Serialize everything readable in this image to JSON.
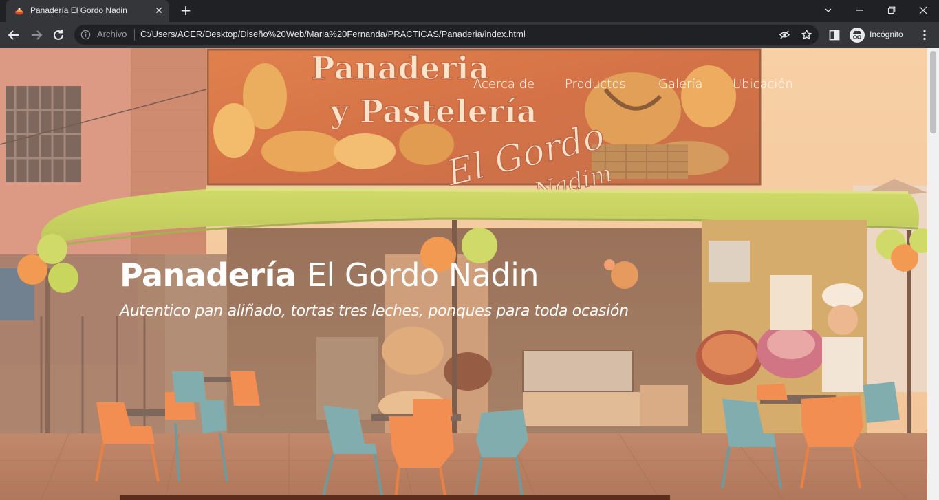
{
  "browser": {
    "tab_title": "Panadería El Gordo Nadin",
    "omnibox_scheme": "Archivo",
    "url": "C:/Users/ACER/Desktop/Diseño%20Web/Maria%20Fernanda/PRACTICAS/Panaderia/index.html",
    "profile_label": "Incógnito"
  },
  "nav": {
    "items": [
      "Acerca de",
      "Productos",
      "Galería",
      "Ubicación"
    ]
  },
  "hero": {
    "title_bold": "Panadería",
    "title_light": "El Gordo Nadin",
    "subtitle": "Autentico pan aliñado, tortas tres leches, ponques para toda ocasión"
  },
  "sign": {
    "line1": "Panaderia",
    "line2": "y Pastelería",
    "line3": "El Gordo",
    "line4": "Nadim"
  },
  "colors": {
    "chrome_dark": "#202124",
    "chrome_tab": "#35363a",
    "awning_green": "#b9d64a",
    "chair_orange": "#f07a3a",
    "chair_blue": "#5fa2b0"
  }
}
